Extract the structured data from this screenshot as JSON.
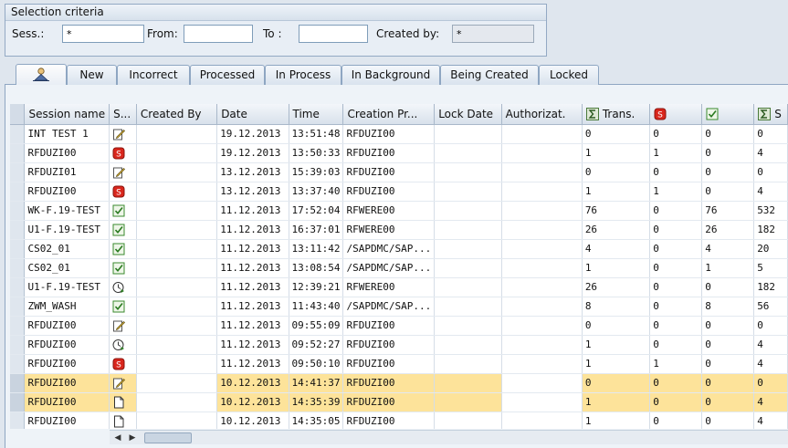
{
  "selection": {
    "title": "Selection criteria",
    "sess_label": "Sess.:",
    "sess_value": "*",
    "from_label": "From:",
    "from_value": "",
    "to_label": "To :",
    "to_value": "",
    "created_by_label": "Created by:",
    "created_by_value": "*"
  },
  "tabs": [
    {
      "label": "",
      "icon": "person-icon"
    },
    {
      "label": "New"
    },
    {
      "label": "Incorrect"
    },
    {
      "label": "Processed"
    },
    {
      "label": "In Process"
    },
    {
      "label": "In Background"
    },
    {
      "label": "Being Created"
    },
    {
      "label": "Locked"
    }
  ],
  "columns": {
    "session_name": "Session name",
    "status": "S...",
    "created_by": "Created By",
    "date": "Date",
    "time": "Time",
    "creation_program": "Creation Pr...",
    "lock_date": "Lock Date",
    "authorization": "Authorizat.",
    "transactions": "Trans.",
    "errors": "",
    "processed": "",
    "total": "S"
  },
  "rows": [
    {
      "name": "INT TEST 1",
      "status": "edit",
      "date": "19.12.2013",
      "time": "13:51:48",
      "prog": "RFDUZI00",
      "trans": "0",
      "err": "0",
      "proc": "0",
      "tot": "0",
      "hl": false
    },
    {
      "name": "RFDUZI00",
      "status": "error",
      "date": "19.12.2013",
      "time": "13:50:33",
      "prog": "RFDUZI00",
      "trans": "1",
      "err": "1",
      "proc": "0",
      "tot": "4",
      "hl": false
    },
    {
      "name": "RFDUZI01",
      "status": "edit",
      "date": "13.12.2013",
      "time": "15:39:03",
      "prog": "RFDUZI00",
      "trans": "0",
      "err": "0",
      "proc": "0",
      "tot": "0",
      "hl": false
    },
    {
      "name": "RFDUZI00",
      "status": "error",
      "date": "13.12.2013",
      "time": "13:37:40",
      "prog": "RFDUZI00",
      "trans": "1",
      "err": "1",
      "proc": "0",
      "tot": "4",
      "hl": false
    },
    {
      "name": "WK-F.19-TEST",
      "status": "ok",
      "date": "11.12.2013",
      "time": "17:52:04",
      "prog": "RFWERE00",
      "trans": "76",
      "err": "0",
      "proc": "76",
      "tot": "532",
      "hl": false
    },
    {
      "name": "U1-F.19-TEST",
      "status": "ok",
      "date": "11.12.2013",
      "time": "16:37:01",
      "prog": "RFWERE00",
      "trans": "26",
      "err": "0",
      "proc": "26",
      "tot": "182",
      "hl": false
    },
    {
      "name": "CS02_01",
      "status": "ok",
      "date": "11.12.2013",
      "time": "13:11:42",
      "prog": "/SAPDMC/SAP...",
      "trans": "4",
      "err": "0",
      "proc": "4",
      "tot": "20",
      "hl": false
    },
    {
      "name": "CS02_01",
      "status": "ok",
      "date": "11.12.2013",
      "time": "13:08:54",
      "prog": "/SAPDMC/SAP...",
      "trans": "1",
      "err": "0",
      "proc": "1",
      "tot": "5",
      "hl": false
    },
    {
      "name": "U1-F.19-TEST",
      "status": "running",
      "date": "11.12.2013",
      "time": "12:39:21",
      "prog": "RFWERE00",
      "trans": "26",
      "err": "0",
      "proc": "0",
      "tot": "182",
      "hl": false
    },
    {
      "name": "ZWM_WASH",
      "status": "ok",
      "date": "11.12.2013",
      "time": "11:43:40",
      "prog": "/SAPDMC/SAP...",
      "trans": "8",
      "err": "0",
      "proc": "8",
      "tot": "56",
      "hl": false
    },
    {
      "name": "RFDUZI00",
      "status": "edit",
      "date": "11.12.2013",
      "time": "09:55:09",
      "prog": "RFDUZI00",
      "trans": "0",
      "err": "0",
      "proc": "0",
      "tot": "0",
      "hl": false
    },
    {
      "name": "RFDUZI00",
      "status": "running",
      "date": "11.12.2013",
      "time": "09:52:27",
      "prog": "RFDUZI00",
      "trans": "1",
      "err": "0",
      "proc": "0",
      "tot": "4",
      "hl": false
    },
    {
      "name": "RFDUZI00",
      "status": "error",
      "date": "11.12.2013",
      "time": "09:50:10",
      "prog": "RFDUZI00",
      "trans": "1",
      "err": "1",
      "proc": "0",
      "tot": "4",
      "hl": false
    },
    {
      "name": "RFDUZI00",
      "status": "edit",
      "date": "10.12.2013",
      "time": "14:41:37",
      "prog": "RFDUZI00",
      "trans": "0",
      "err": "0",
      "proc": "0",
      "tot": "0",
      "hl": true
    },
    {
      "name": "RFDUZI00",
      "status": "new",
      "date": "10.12.2013",
      "time": "14:35:39",
      "prog": "RFDUZI00",
      "trans": "1",
      "err": "0",
      "proc": "0",
      "tot": "4",
      "hl": true
    },
    {
      "name": "RFDUZI00",
      "status": "new",
      "date": "10.12.2013",
      "time": "14:35:05",
      "prog": "RFDUZI00",
      "trans": "1",
      "err": "0",
      "proc": "0",
      "tot": "4",
      "hl": false
    }
  ],
  "colors": {
    "highlight": "#fde39a",
    "error": "#d9261c",
    "ok": "#3a8a2e"
  }
}
